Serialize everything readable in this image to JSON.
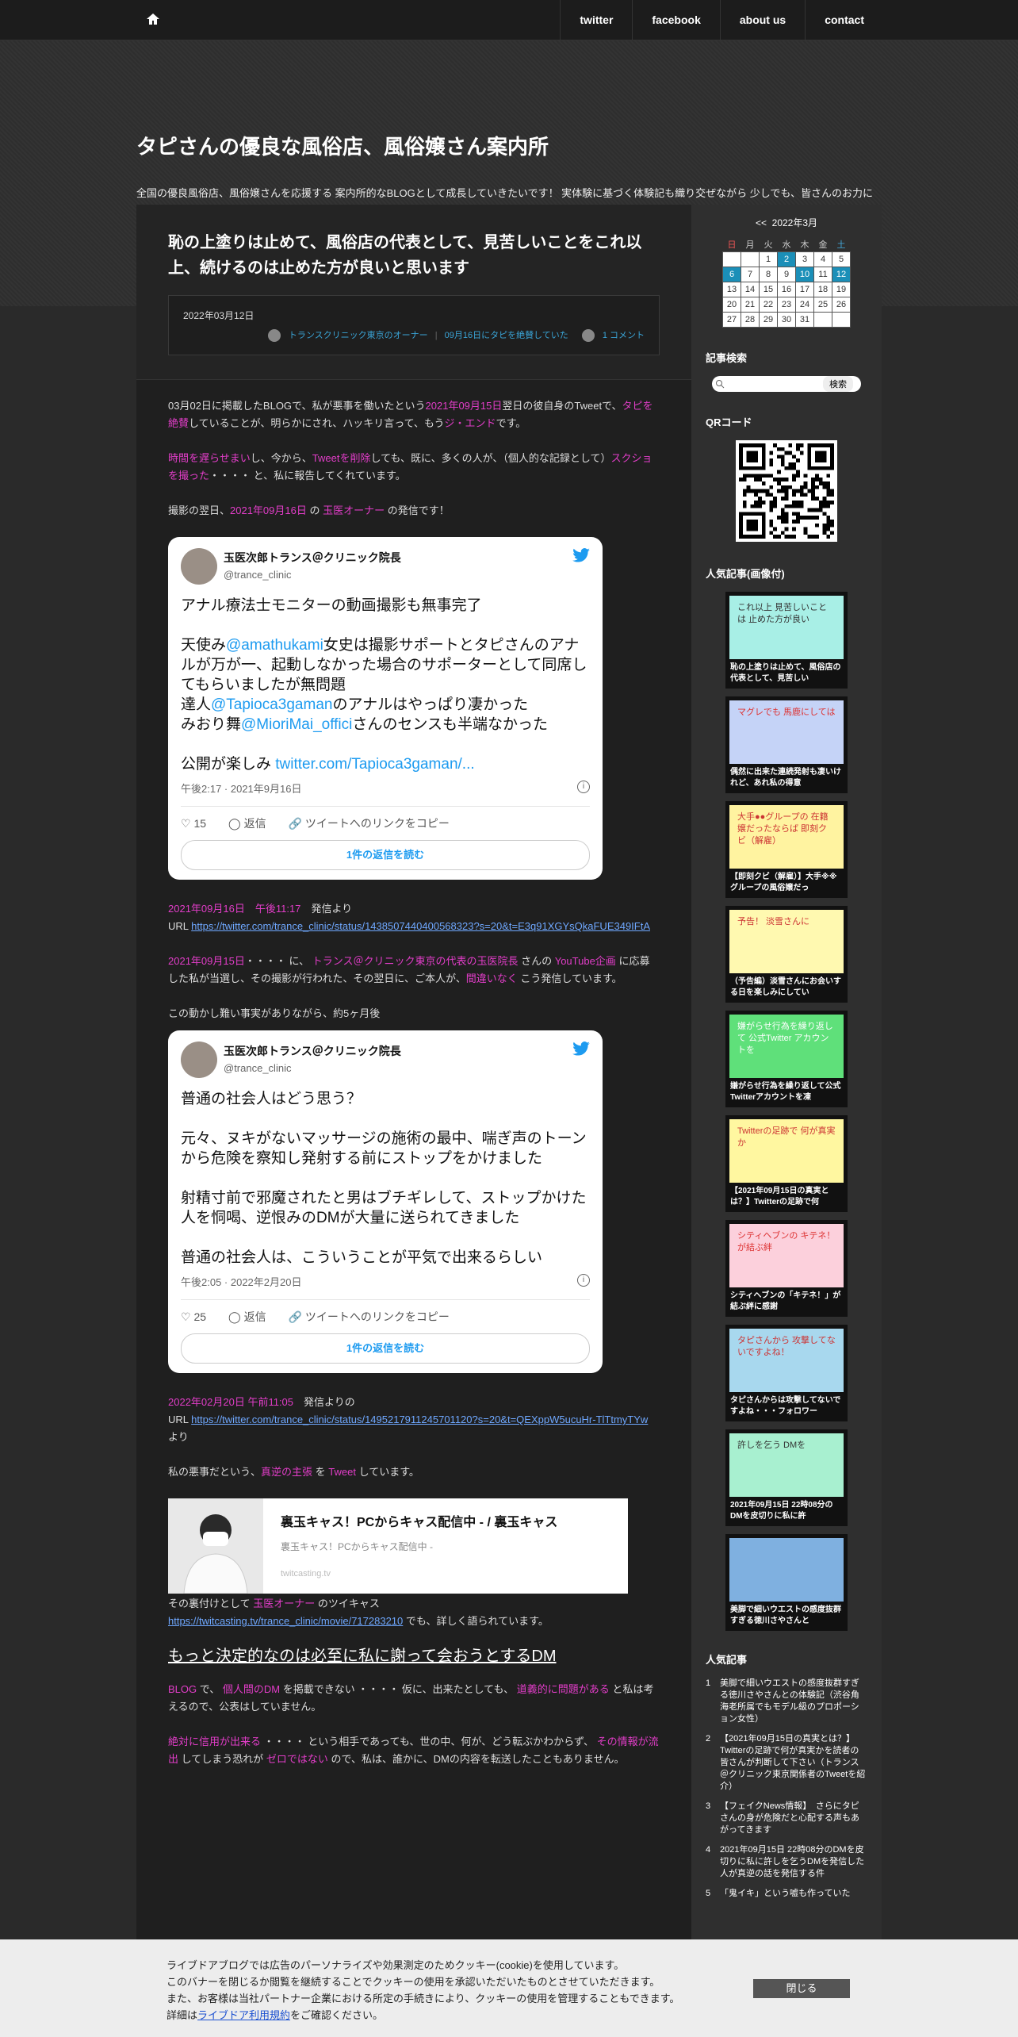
{
  "nav": {
    "links": [
      "twitter",
      "facebook",
      "about us",
      "contact"
    ]
  },
  "header": {
    "title": "タピさんの優良な風俗店、風俗嬢さん案内所",
    "desc": "全国の優良風俗店、風俗嬢さんを応援する 案内所的なBLOGとして成長していきたいです！ 実体験に基づく体験記も織り交ぜながら 少しでも、皆さんのお力になれたらと思っております"
  },
  "post": {
    "title": "恥の上塗りは止めて、風俗店の代表として、見苦しいことをこれ以上、続けるのは止めた方が良いと思います",
    "date": "2022年03月12日",
    "category": "トランスクリニック東京のオーナー",
    "tag": "09月16日にタピを絶賛していた",
    "comments": "1 コメント",
    "p1": {
      "a": "03月02日に掲載したBLOGで、私が悪事を働いたという",
      "b": "2021年09月15日",
      "c": "翌日の彼自身のTweetで、",
      "d": "タピを絶賛",
      "e": "していることが、明らかにされ、ハッキリ言って、もう",
      "f": "ジ・エンド",
      "g": "です。"
    },
    "p2": {
      "a": "時間を遅らせまい",
      "b": "し、今から、",
      "c": "Tweetを削除",
      "d": "しても、既に、多くの人が、（個人的な記録として）",
      "e": "スクショを撮った",
      "f": "・・・・ と、私に報告してくれています。"
    },
    "p3": {
      "a": "撮影の翌日、",
      "b": "2021年09月16日",
      "c": "の",
      "d": "玉医オーナー",
      "e": "の発信です！"
    },
    "tweet1": {
      "name": "玉医次郎トランス＠クリニック院長",
      "handle": "@trance_clinic",
      "l1": "アナル療法士モニターの動画撮影も無事完了",
      "l2a": "天使み",
      "l2b": "@amathukami",
      "l2c": "女史は撮影サポートとタピさんのアナルが万が一、起動しなかった場合のサポーターとして同席してもらいましたが無問題",
      "l3a": "達人",
      "l3b": "@Tapioca3gaman",
      "l3c": "のアナルはやっぱり凄かった",
      "l4a": "みおり舞",
      "l4b": "@MioriMai_offici",
      "l4c": "さんのセンスも半端なかった",
      "l5a": "公開が楽しみ ",
      "l5b": "twitter.com/Tapioca3gaman/...",
      "time": "午後2:17 · 2021年9月16日",
      "likes": "15",
      "reply": "返信",
      "copy": "ツイートへのリンクをコピー",
      "read": "1件の返信を読む"
    },
    "p4": {
      "a": "2021年09月16日　午後11:17",
      "b": "発信より",
      "c": "URL",
      "d": "https://twitter.com/trance_clinic/status/1438507440400568323?s=20&t=E3q91XGYsQkaFUE349IFtA"
    },
    "p5": {
      "a": "2021年09月15日",
      "b": "・・・・ に、",
      "c": "トランス＠クリニック東京の代表の玉医院長",
      "d": "さんの",
      "e": "YouTube企画",
      "f": "に応募した私が当選し、その撮影が行われた、その翌日に、ご本人が、",
      "g": "間違いなく",
      "h": "こう発信しています。"
    },
    "p6": "この動かし難い事実がありながら、約5ヶ月後",
    "tweet2": {
      "name": "玉医次郎トランス＠クリニック院長",
      "handle": "@trance_clinic",
      "l1": "普通の社会人はどう思う？",
      "l2": "元々、ヌキがないマッサージの施術の最中、喘ぎ声のトーンから危険を察知し発射する前にストップをかけました",
      "l3": "射精寸前で邪魔されたと男はブチギレして、ストップかけた人を恫喝、逆恨みのDMが大量に送られてきました",
      "l4": "普通の社会人は、こういうことが平気で出来るらしい",
      "time": "午後2:05 · 2022年2月20日",
      "likes": "25",
      "reply": "返信",
      "copy": "ツイートへのリンクをコピー",
      "read": "1件の返信を読む"
    },
    "p7": {
      "a": "2022年02月20日 午前11:05",
      "b": "発信よりの",
      "c": "URL",
      "d": "https://twitter.com/trance_clinic/status/1495217911245701120?s=20&t=QEXppW5ucuHr-TlTtmyTYw",
      "e": "より"
    },
    "p8": {
      "a": "私の悪事だという、",
      "b": "真逆の主張",
      "c": "を",
      "d": "Tweet",
      "e": "しています。"
    },
    "card": {
      "title": "裏玉キャス！PCからキャス配信中 - / 裏玉キャス",
      "desc": "裏玉キャス！PCからキャス配信中 -",
      "url": "twitcasting.tv"
    },
    "p9": {
      "a": "その裏付けとして",
      "b": "玉医オーナー",
      "c": "のツイキャス",
      "d": "https://twitcasting.tv/trance_clinic/movie/717283210",
      "e": "でも、詳しく語られています。"
    },
    "h2": "もっと決定的なのは必至に私に謝って会おうとするDM",
    "p10": {
      "a": "BLOG",
      "b": "で、",
      "c": "個人間のDM",
      "d": "を掲載できない ・・・・ 仮に、出来たとしても、",
      "e": "道義的に問題がある",
      "f": "と私は考えるので、公表はしていません。"
    },
    "p11": {
      "a": "絶対に信用が出来る",
      "b": "・・・・ という相手であっても、世の中、何が、どう転ぶかわからず、",
      "c": "その情報が流出",
      "d": "してしまう恐れが",
      "e": "ゼロではない",
      "f": "ので、私は、誰かに、DMの内容を転送したこともありません。"
    }
  },
  "sidebar": {
    "cal": {
      "title": "2022年3月",
      "prev": "<<",
      "days": [
        "日",
        "月",
        "火",
        "水",
        "木",
        "金",
        "土"
      ],
      "weeks": [
        [
          "",
          "",
          "1",
          "2",
          "3",
          "4",
          "5"
        ],
        [
          "6",
          "7",
          "8",
          "9",
          "10",
          "11",
          "12"
        ],
        [
          "13",
          "14",
          "15",
          "16",
          "17",
          "18",
          "19"
        ],
        [
          "20",
          "21",
          "22",
          "23",
          "24",
          "25",
          "26"
        ],
        [
          "27",
          "28",
          "29",
          "30",
          "31",
          "",
          ""
        ]
      ]
    },
    "search_head": "記事検索",
    "search_btn": "検索",
    "qr_head": "QRコード",
    "img_head": "人気記事(画像付)",
    "thumbs": [
      {
        "img": "これ以上 見苦しいことは 止めた方が良い",
        "cap": "恥の上塗りは止めて、風俗店の代表として、見苦しい",
        "bg": "#a8efe6",
        "fg": "#333"
      },
      {
        "img": "マグレでも 馬鹿にしては",
        "cap": "偶然に出来た連続発射も凄いけれど、あれ私の得意",
        "bg": "#c5d3f7",
        "fg": "#d33"
      },
      {
        "img": "大手●●グループの 在籍嬢だったならば 即刻クビ（解雇）",
        "cap": "【即刻クビ（解雇）】大手※※グループの風俗嬢だっ",
        "bg": "#fff3a0",
        "fg": "#c33"
      },
      {
        "img": "予告！ 淡雪さんに",
        "cap": "（予告編）淡雪さんにお会いする日を楽しみにしてい",
        "bg": "#fff9b0",
        "fg": "#c33"
      },
      {
        "img": "嫌がらせ行為を繰り返して 公式Twitter アカウントを",
        "cap": "嫌がらせ行為を繰り返して公式Twitterアカウントを凍",
        "bg": "#5fe07a",
        "fg": "#fff"
      },
      {
        "img": "Twitterの足跡で 何が真実か",
        "cap": "【2021年09月15日の真実とは？】Twitterの足跡で何",
        "bg": "#fff7a0",
        "fg": "#c33"
      },
      {
        "img": "シティヘブンの キテネ！が結ぶ絆",
        "cap": "シティヘブンの「キテネ！」が結ぶ絆に感謝",
        "bg": "#fcd0dc",
        "fg": "#d33"
      },
      {
        "img": "タピさんから 攻撃してないですよね！",
        "cap": "タピさんからは攻撃してないですよね・・・フォロワー",
        "bg": "#a8d8ee",
        "fg": "#c33"
      },
      {
        "img": "許しを乞う DMを",
        "cap": "2021年09月15日 22時08分のDMを皮切りに私に許",
        "bg": "#a8f0d0",
        "fg": "#333"
      },
      {
        "img": "",
        "cap": "美脚で細いウエストの感度抜群すぎる徳川さやさんと",
        "bg": "#7fb0e0",
        "fg": "#333"
      }
    ],
    "pop_head": "人気記事",
    "pop": [
      {
        "n": "1",
        "t": "美脚で細いウエストの感度抜群すぎる徳川さやさんとの体験記（渋谷角海老所属でもモデル級のプロポーション女性）"
      },
      {
        "n": "2",
        "t": "【2021年09月15日の真実とは？】Twitterの足跡で何が真実かを読者の皆さんが判断して下さい（トランス＠クリニック東京関係者のTweetを紹介）"
      },
      {
        "n": "3",
        "t": "【フェイクNews情報】　さらにタピさんの身が危険だと心配する声もあがってきます"
      },
      {
        "n": "4",
        "t": "2021年09月15日 22時08分のDMを皮切りに私に許しを乞うDMを発信した人が真逆の話を発信する件"
      },
      {
        "n": "5",
        "t": "「鬼イキ」という嘘も作っていた"
      }
    ]
  },
  "cookie": {
    "l1": "ライブドアブログでは広告のパーソナライズや効果測定のためクッキー(cookie)を使用しています。",
    "l2": "このバナーを閉じるか閲覧を継続することでクッキーの使用を承認いただいたものとさせていただきます。",
    "l3": "また、お客様は当社パートナー企業における所定の手続きにより、クッキーの使用を管理することもできます。",
    "l4a": "詳細は",
    "l4b": "ライブドア利用規約",
    "l4c": "をご確認ください。",
    "close": "閉じる"
  }
}
